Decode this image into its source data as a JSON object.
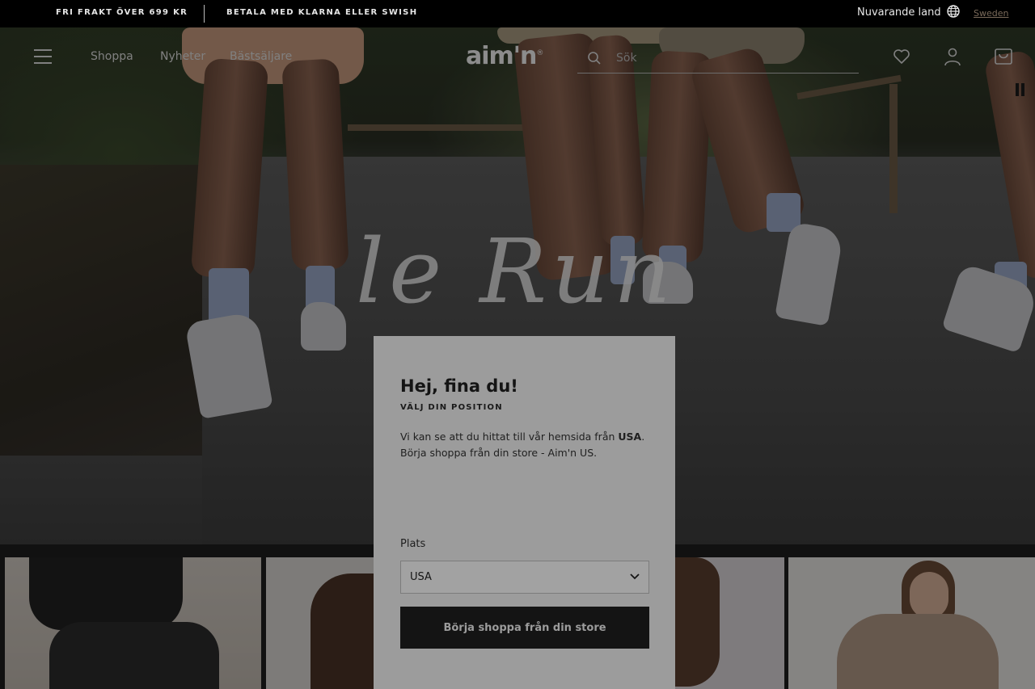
{
  "promo": {
    "left": "FRI FRAKT ÖVER 699 KR",
    "right": "BETALA MED KLARNA ELLER SWISH"
  },
  "country_selector": {
    "label": "Nuvarande land",
    "link": "Sweden",
    "icon": "globe-icon"
  },
  "header": {
    "logo": "aim'n",
    "logo_mark": "®",
    "nav": [
      "Shoppa",
      "Nyheter",
      "Bästsäljare"
    ],
    "search_placeholder": "Sök",
    "icons": [
      "menu-icon",
      "search-icon",
      "heart-icon",
      "user-icon",
      "bag-icon"
    ]
  },
  "hero": {
    "title": "le Run",
    "controls": {
      "icon": "pause-icon"
    }
  },
  "modal": {
    "title": "Hej, fina du!",
    "subtitle": "VÄLJ DIN POSITION",
    "body_prefix": "Vi kan se att du hittat till vår hemsida från ",
    "body_country": "USA",
    "body_suffix": ".",
    "body_line2": "Börja shoppa från din store - Aim'n US.",
    "field_label": "Plats",
    "select_value": "USA",
    "cta": "Börja shoppa från din store"
  },
  "colors": {
    "modal_bg": "#9c9c9c",
    "cta_bg": "#141414",
    "promo_bg": "#000000"
  }
}
